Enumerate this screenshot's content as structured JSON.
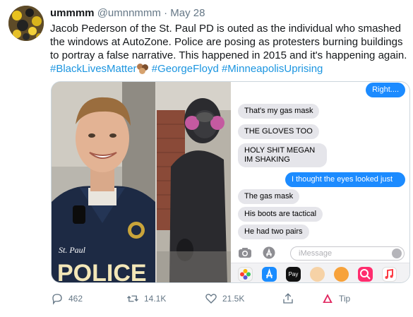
{
  "tweet": {
    "display_name": "ummmm",
    "handle": "@umnnmmm",
    "separator": "·",
    "date": "May 28",
    "text_main": "Jacob Pederson of the St. Paul PD is outed as the individual who smashed the windows at AutoZone. Police are posing as protesters burning buildings to portray a false narrative. This happened in 2015 and it's happening again.",
    "hashtags": [
      "#BlackLivesMatter",
      "#GeorgeFloyd",
      "#MinneapolisUprising"
    ]
  },
  "media": {
    "photo_1_text": "St. Paul",
    "photo_1_partial": "POLICE",
    "messages": [
      {
        "text": "Right....",
        "from": "me"
      },
      {
        "text": "That's my gas mask",
        "from": "them"
      },
      {
        "text": "THE GLOVES TOO",
        "from": "them"
      },
      {
        "text": "HOLY SHIT MEGAN IM SHAKING",
        "from": "them"
      },
      {
        "text": "I thought the eyes looked just",
        "from": "me"
      },
      {
        "text": "The gas mask",
        "from": "them"
      },
      {
        "text": "His boots are tactical",
        "from": "them"
      },
      {
        "text": "He had two pairs",
        "from": "them"
      }
    ],
    "imessage_placeholder": "iMessage",
    "apple_pay_label": "Pay"
  },
  "actions": {
    "reply_count": "462",
    "retweet_count": "14.1K",
    "like_count": "21.5K",
    "tip_label": "Tip"
  },
  "colors": {
    "hashtag": "#1b95e0",
    "bubble_out": "#1c8bff",
    "bubble_in": "#e5e5ea",
    "muted": "#657786"
  }
}
